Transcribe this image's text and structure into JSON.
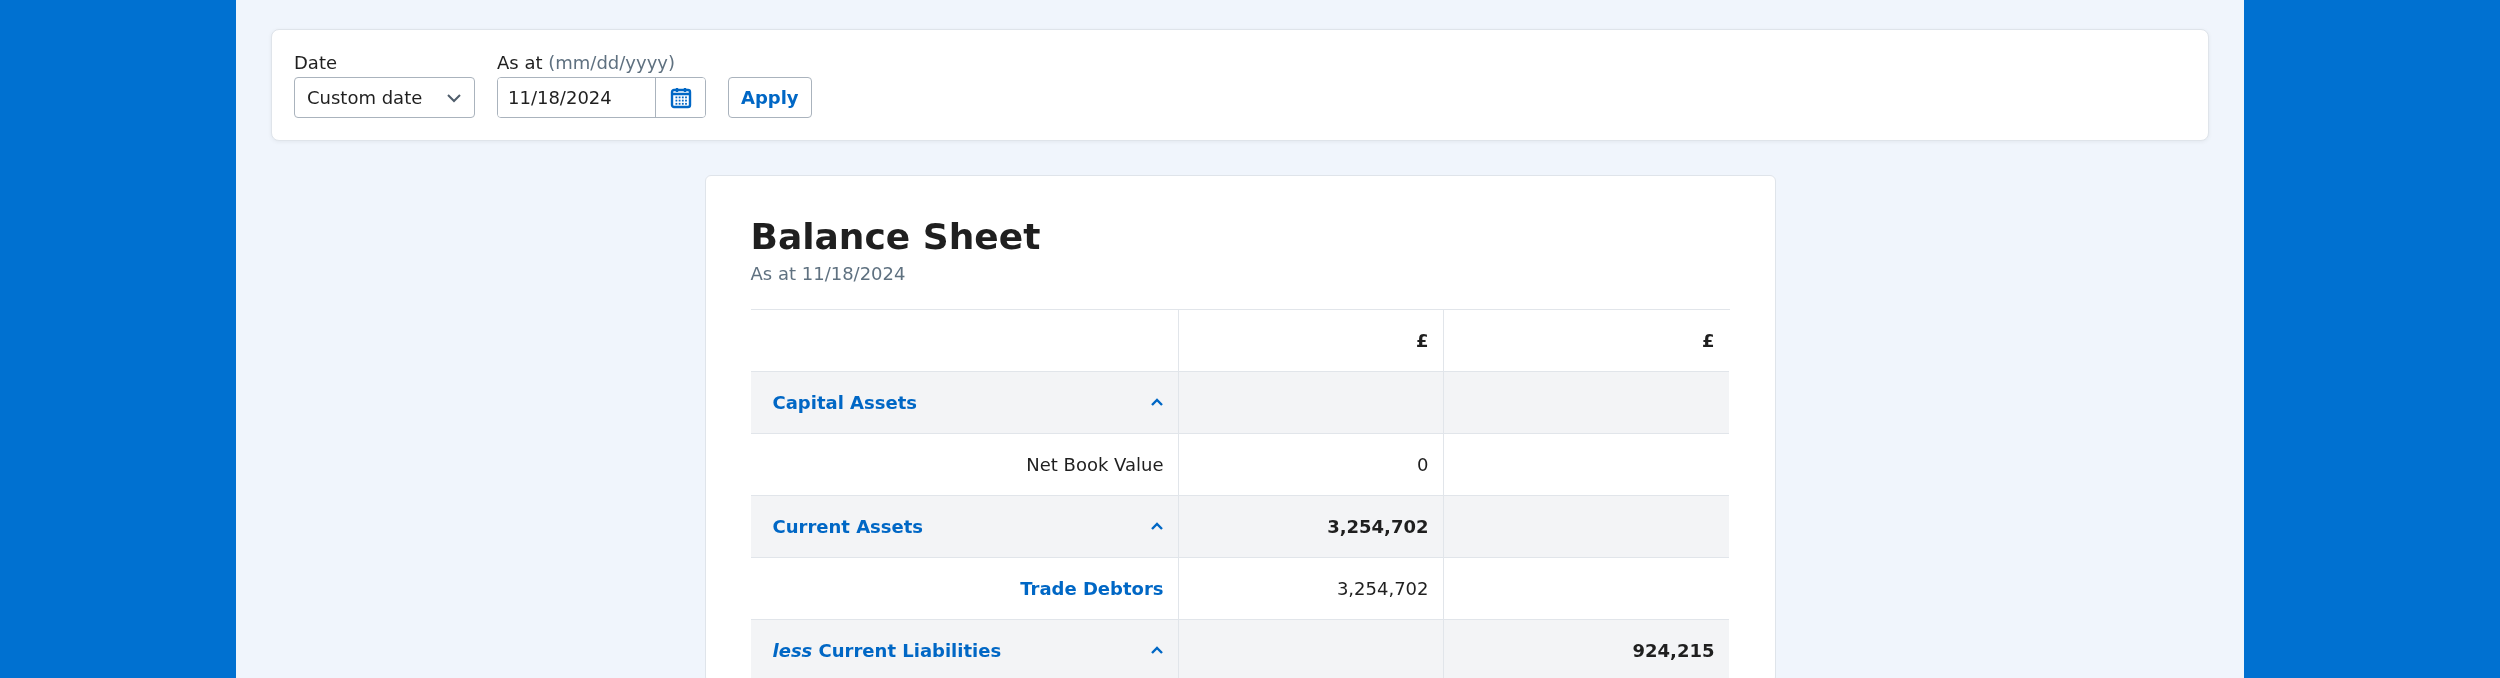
{
  "filters": {
    "date": {
      "label": "Date",
      "value": "Custom date"
    },
    "as_at": {
      "label": "As at",
      "hint": "(mm/dd/yyyy)",
      "value": "11/18/2024"
    },
    "apply": "Apply"
  },
  "report": {
    "title": "Balance Sheet",
    "subtitle": "As at 11/18/2024",
    "columns": {
      "amount_1": "£",
      "amount_2": "£"
    },
    "rows": [
      {
        "kind": "section",
        "label": "Capital Assets",
        "expanded": true
      },
      {
        "kind": "line",
        "label": "Net Book Value",
        "link": false,
        "amount_1": "0"
      },
      {
        "kind": "section",
        "label": "Current Assets",
        "expanded": true,
        "amount_1": "3,254,702"
      },
      {
        "kind": "line",
        "label": "Trade Debtors",
        "link": true,
        "amount_1": "3,254,702"
      },
      {
        "kind": "section",
        "label": "*less* Current Liabilities",
        "expanded": true,
        "amount_2": "924,215"
      }
    ]
  }
}
